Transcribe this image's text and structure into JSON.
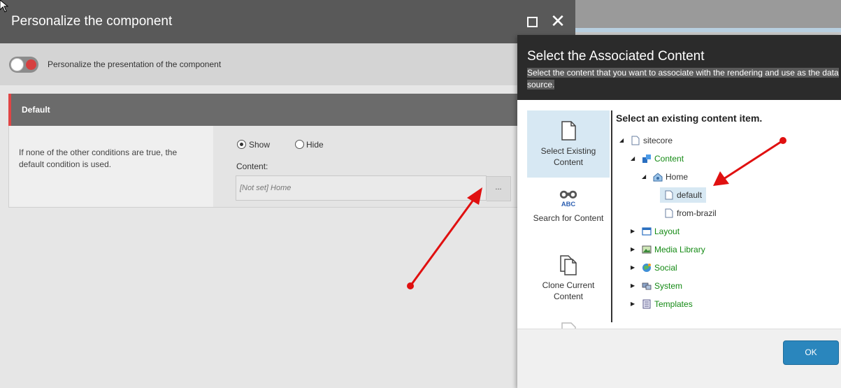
{
  "personalize_dialog": {
    "title": "Personalize the component",
    "toggle_label": "Personalize the presentation of the component",
    "rule": {
      "name": "Default",
      "description": "If none of the other conditions are true, the default condition is used.",
      "show_label": "Show",
      "hide_label": "Hide",
      "selected_option": "Show",
      "content_label": "Content:",
      "content_value": "[Not set] Home",
      "browse_label": "..."
    }
  },
  "associated_dialog": {
    "title": "Select the Associated Content",
    "subtitle": "Select the content that you want to associate with the rendering and use as the data source.",
    "tabs": [
      {
        "label": "Select Existing Content",
        "icon": "document-icon",
        "selected": true
      },
      {
        "label": "Search for Content",
        "icon": "binoculars-icon",
        "selected": false
      },
      {
        "label": "Clone Current Content",
        "icon": "clone-icon",
        "selected": false
      }
    ],
    "tree_heading": "Select an existing content item.",
    "tree": [
      {
        "label": "sitecore",
        "expanded": true,
        "icon": "document-icon"
      },
      {
        "label": "Content",
        "expanded": true,
        "icon": "content-icon"
      },
      {
        "label": "Home",
        "expanded": true,
        "icon": "home-icon"
      },
      {
        "label": "default",
        "selected": true,
        "icon": "document-icon"
      },
      {
        "label": "from-brazil",
        "icon": "document-icon"
      },
      {
        "label": "Layout",
        "expanded": false,
        "icon": "layout-icon"
      },
      {
        "label": "Media Library",
        "expanded": false,
        "icon": "media-library-icon"
      },
      {
        "label": "Social",
        "expanded": false,
        "icon": "social-icon"
      },
      {
        "label": "System",
        "expanded": false,
        "icon": "system-icon"
      },
      {
        "label": "Templates",
        "expanded": false,
        "icon": "templates-icon"
      }
    ],
    "ok_label": "OK"
  },
  "colors": {
    "accent_red": "#e04545",
    "tree_green": "#148a14",
    "ok_blue": "#2a86bd",
    "annotation_red": "#e01010"
  }
}
